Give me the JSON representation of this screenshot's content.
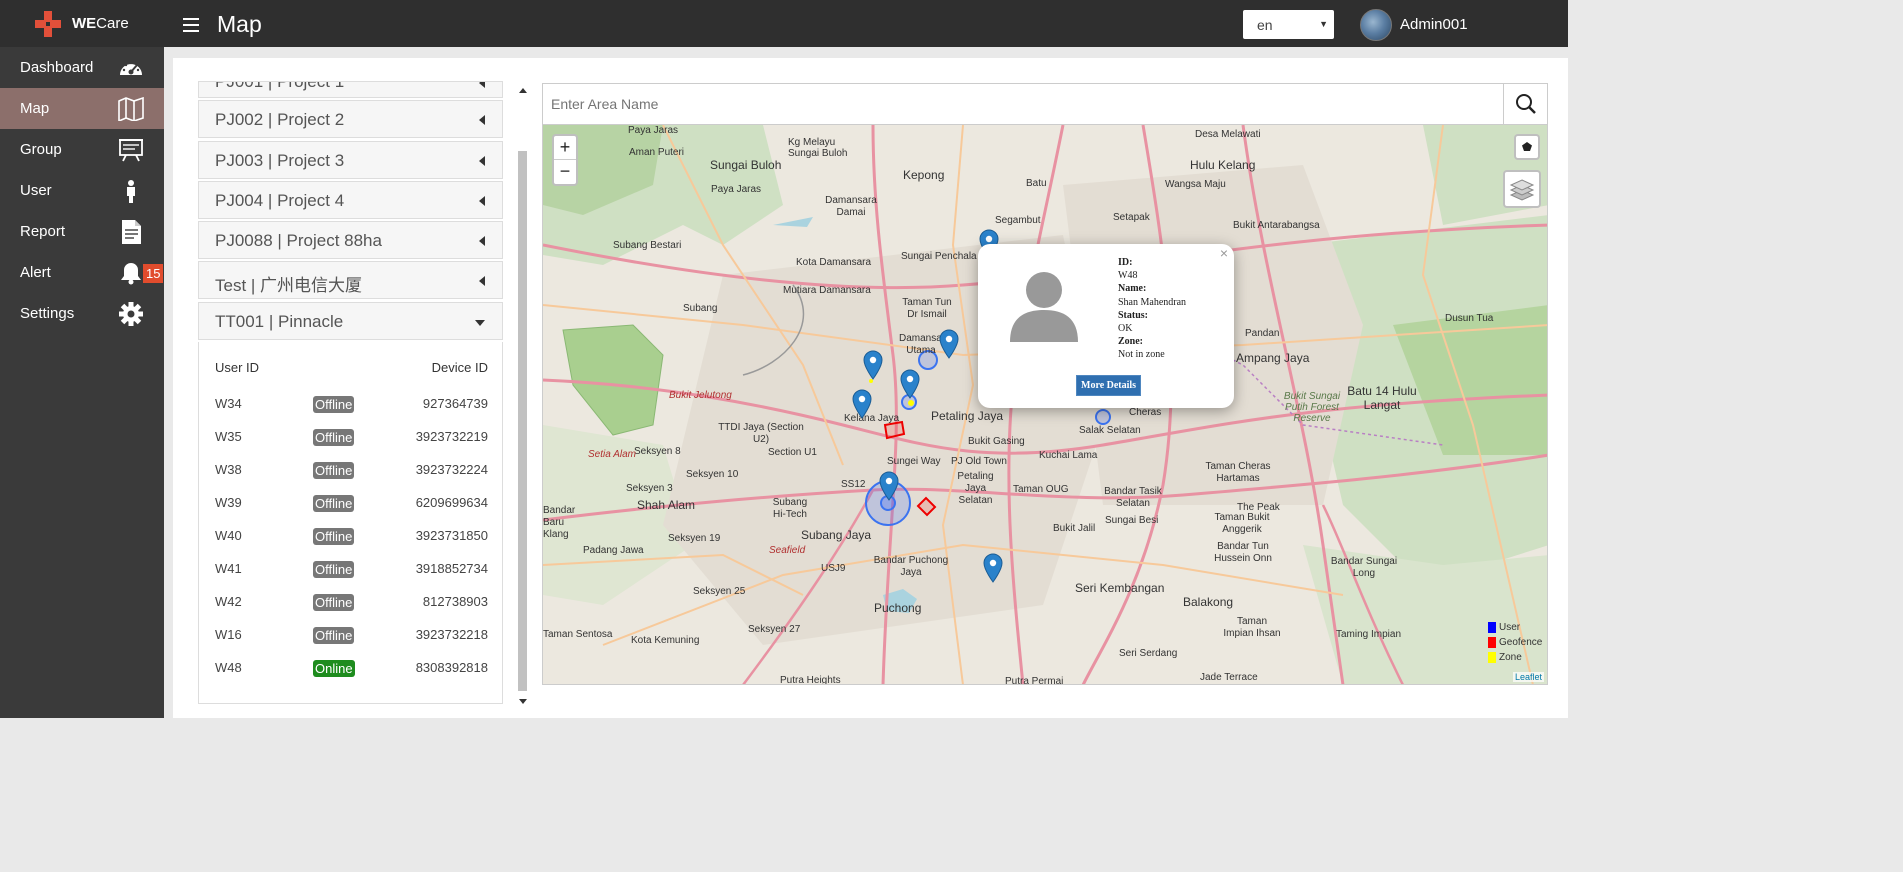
{
  "brand": {
    "we": "WE",
    "care": "Care"
  },
  "header": {
    "title": "Map",
    "language": "en",
    "username": "Admin001"
  },
  "sidebar": {
    "items": [
      {
        "label": "Dashboard",
        "icon": "speedometer-icon"
      },
      {
        "label": "Map",
        "icon": "map-icon",
        "active": true
      },
      {
        "label": "Group",
        "icon": "presentation-board-icon"
      },
      {
        "label": "User",
        "icon": "person-icon"
      },
      {
        "label": "Report",
        "icon": "document-icon"
      },
      {
        "label": "Alert",
        "icon": "bell-icon",
        "badge": "15"
      },
      {
        "label": "Settings",
        "icon": "gear-icon"
      }
    ]
  },
  "projects": [
    {
      "label": "PJ001 | Project 1"
    },
    {
      "label": "PJ002 | Project 2"
    },
    {
      "label": "PJ003 | Project 3"
    },
    {
      "label": "PJ004 | Project 4"
    },
    {
      "label": "PJ0088 | Project 88ha"
    },
    {
      "label": "Test | 广州电信大厦"
    },
    {
      "label": "TT001 | Pinnacle",
      "expanded": true
    }
  ],
  "device_table": {
    "headers": {
      "user_id": "User ID",
      "device_id": "Device ID"
    },
    "rows": [
      {
        "user_id": "W34",
        "status": "Offline",
        "device_id": "927364739"
      },
      {
        "user_id": "W35",
        "status": "Offline",
        "device_id": "3923732219"
      },
      {
        "user_id": "W38",
        "status": "Offline",
        "device_id": "3923732224"
      },
      {
        "user_id": "W39",
        "status": "Offline",
        "device_id": "6209699634"
      },
      {
        "user_id": "W40",
        "status": "Offline",
        "device_id": "3923731850"
      },
      {
        "user_id": "W41",
        "status": "Offline",
        "device_id": "3918852734"
      },
      {
        "user_id": "W42",
        "status": "Offline",
        "device_id": "812738903"
      },
      {
        "user_id": "W16",
        "status": "Offline",
        "device_id": "3923732218"
      },
      {
        "user_id": "W48",
        "status": "Online",
        "device_id": "8308392818"
      }
    ]
  },
  "search": {
    "placeholder": "Enter Area Name"
  },
  "map": {
    "zoom_in": "+",
    "zoom_out": "−",
    "places": [
      {
        "name": "Paya Jaras"
      },
      {
        "name": "Aman Puteri"
      },
      {
        "name": "Kg Melayu Sungai Buloh"
      },
      {
        "name": "Sungai Buloh"
      },
      {
        "name": "Paya Jaras"
      },
      {
        "name": "Kepong"
      },
      {
        "name": "Batu"
      },
      {
        "name": "Desa Melawati"
      },
      {
        "name": "Hulu Kelang"
      },
      {
        "name": "Wangsa Maju"
      },
      {
        "name": "Damansara Damai"
      },
      {
        "name": "Segambut"
      },
      {
        "name": "Setapak"
      },
      {
        "name": "Bukit Antarabangsa"
      },
      {
        "name": "Subang Bestari"
      },
      {
        "name": "Kota Damansara"
      },
      {
        "name": "Sungai Penchala"
      },
      {
        "name": "Mutiara Damansara"
      },
      {
        "name": "Taman Tun Dr Ismail"
      },
      {
        "name": "Subang"
      },
      {
        "name": "Damansara Utama"
      },
      {
        "name": "Petaling Jaya"
      },
      {
        "name": "Kelana Jaya"
      },
      {
        "name": "TTDI Jaya (Section U2)"
      },
      {
        "name": "Section U1"
      },
      {
        "name": "Bukit Gasing"
      },
      {
        "name": "Sungei Way"
      },
      {
        "name": "PJ Old Town"
      },
      {
        "name": "Kuchai Lama"
      },
      {
        "name": "Salak Selatan"
      },
      {
        "name": "Cheras"
      },
      {
        "name": "Shah Alam"
      },
      {
        "name": "Seksyen 8"
      },
      {
        "name": "Seksyen 10"
      },
      {
        "name": "Seksyen 3"
      },
      {
        "name": "SS12"
      },
      {
        "name": "Subang Hi-Tech"
      },
      {
        "name": "Subang Jaya"
      },
      {
        "name": "Petaling Jaya Selatan"
      },
      {
        "name": "Taman OUG"
      },
      {
        "name": "Bandar Tasik Selatan"
      },
      {
        "name": "Sungai Besi"
      },
      {
        "name": "Bukit Jalil"
      },
      {
        "name": "Taman Cheras Hartamas"
      },
      {
        "name": "The Peak"
      },
      {
        "name": "Taman Bukit Anggerik"
      },
      {
        "name": "Bandar Tun Hussein Onn"
      },
      {
        "name": "Bandar Sungai Long"
      },
      {
        "name": "Padang Jawa"
      },
      {
        "name": "Seksyen 19"
      },
      {
        "name": "USJ9"
      },
      {
        "name": "Bandar Puchong Jaya"
      },
      {
        "name": "Puchong"
      },
      {
        "name": "Seri Kembangan"
      },
      {
        "name": "Balakong"
      },
      {
        "name": "Taman Impian Ihsan"
      },
      {
        "name": "Taming Impian"
      },
      {
        "name": "Seksyen 25"
      },
      {
        "name": "Seksyen 27"
      },
      {
        "name": "Kota Kemuning"
      },
      {
        "name": "Putra Heights"
      },
      {
        "name": "Seri Serdang"
      },
      {
        "name": "Putra Permai"
      },
      {
        "name": "Jade Terrace"
      },
      {
        "name": "Batu 14 Hulu Langat"
      },
      {
        "name": "Dusun Tua"
      },
      {
        "name": "Bukit Sungai Putih Forest Reserve"
      },
      {
        "name": "Ampang Jaya"
      },
      {
        "name": "Pandan"
      },
      {
        "name": "Taman Sentosa"
      },
      {
        "name": "Bandar Baru Klang"
      },
      {
        "name": "Setia Alam"
      },
      {
        "name": "Bukit Jelutong"
      },
      {
        "name": "Seafield"
      }
    ],
    "popup": {
      "id_label": "ID:",
      "id": "W48",
      "name_label": "Name:",
      "name": "Shan Mahendran",
      "status_label": "Status:",
      "status": "OK",
      "zone_label": "Zone:",
      "zone": "Not in zone",
      "button": "More Details",
      "close": "×"
    },
    "legend": [
      {
        "label": "User",
        "color": "#0000ff"
      },
      {
        "label": "Geofence",
        "color": "#ff0000"
      },
      {
        "label": "Zone",
        "color": "#ffff00"
      }
    ],
    "attribution": "Leaflet"
  }
}
